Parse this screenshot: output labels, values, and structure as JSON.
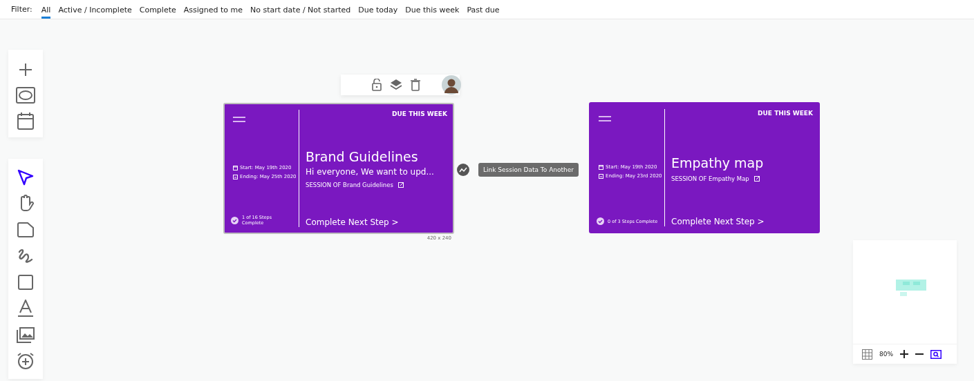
{
  "filter_bar": {
    "label": "Filter:",
    "options": [
      {
        "label": "All",
        "selected": true
      },
      {
        "label": "Active / Incomplete",
        "selected": false
      },
      {
        "label": "Complete",
        "selected": false
      },
      {
        "label": "Assigned to me",
        "selected": false
      },
      {
        "label": "No start date / Not started",
        "selected": false
      },
      {
        "label": "Due today",
        "selected": false
      },
      {
        "label": "Due this week",
        "selected": false
      },
      {
        "label": "Past due",
        "selected": false
      }
    ]
  },
  "insert_toolbar": {
    "tools": [
      {
        "kind": "plus"
      },
      {
        "kind": "ellipse"
      },
      {
        "kind": "calendar"
      }
    ]
  },
  "draw_toolbar": {
    "tools": [
      {
        "kind": "select",
        "selected": true
      },
      {
        "kind": "hand",
        "selected": false
      },
      {
        "kind": "note",
        "selected": false
      },
      {
        "kind": "scribble",
        "selected": false
      },
      {
        "kind": "rect",
        "selected": false
      },
      {
        "kind": "text",
        "selected": false
      },
      {
        "kind": "media",
        "selected": false
      },
      {
        "kind": "alarm",
        "selected": false
      }
    ]
  },
  "cards": [
    {
      "due": "DUE THIS WEEK",
      "title": "Brand Guidelines",
      "description": "Hi everyone, We want to upd...",
      "session": "SESSION OF Brand Guidelines",
      "start": "Start: May 19th 2020",
      "ending": "Ending: May 25th 2020",
      "progress": "1 of 16 Steps Complete",
      "action": "Complete Next Step >",
      "selected": true,
      "size": "420 x 240"
    },
    {
      "due": "DUE THIS WEEK",
      "title": "Empathy map",
      "session": "SESSION OF Empathy Map",
      "start": "Start: May 19th 2020",
      "ending": "Ending: May 23rd 2020",
      "progress": "0 of 3 Steps Complete",
      "action": "Complete Next Step >",
      "selected": false
    }
  ],
  "link_tooltip": "Link Session Data To Another",
  "zoom_controls": {
    "zoom": "80%"
  }
}
